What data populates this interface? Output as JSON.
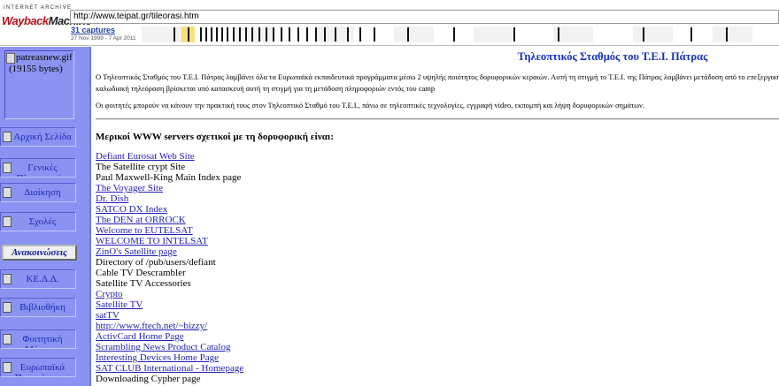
{
  "wayback": {
    "logo_top": "INTERNET ARCHIVE",
    "logo_wayback": "Wayback",
    "logo_machine": "Machine",
    "url": "http://www.teipat.gr/tileorasi.htm",
    "captures": "31 captures",
    "range": "27 Nov 1999 - 7 Apr 2011"
  },
  "nav": {
    "logo_alt_line1": "patreasnew.gif",
    "logo_alt_line2": "(19155 bytes)",
    "items": [
      {
        "label": "Αρχική Σελίδα"
      },
      {
        "label": "Γενικές Πληροφορίες"
      },
      {
        "label": "Διοίκηση"
      },
      {
        "label": "Σχολές"
      },
      {
        "label": "Ανακοινώσεις"
      },
      {
        "label": "ΚΕ.Δ.Δ."
      },
      {
        "label": "Βιβλιοθήκη"
      },
      {
        "label": "Φοιτητική Μέριμνα"
      },
      {
        "label": "Ευρωπαϊκά Προγράμματα"
      }
    ]
  },
  "main": {
    "title": "Τηλεοπτικός Σταθμός του Τ.Ε.Ι. Πάτρας",
    "intro": "Ο Τηλεοπτικός Σταθμός του Τ.Ε.Ι. Πάτρας λαμβάνει όλα τα Ευρωπαϊκά εκπαιδευτικά προγράμματα μέσω 2 υψηλής ποιότητος δορυφορικών κεραιών. Αυτή τη στιγμή το Τ.Ε.Ι. της Πάτρας λαμβάνει μετάδοση από το επεξεργασία τηλεοπτικών προγραμμάτων και τοπικής ραδιοφωνίας εκπαιδευτικών προγραμμάτων. Η καλωδιακή τηλεόραση βρίσκεται υπό κατασκευή αυτή τη στιγμή για τη μετάδοση πληροφοριών εντός του camp",
    "students": "Οι φοιτητές μπορούν να κάνουν την πρακτική τους στον Τηλεοπτικό Σταθμό του Τ.Ε.Ι., πάνω σε   τηλεοπτικές τεχνολογίες, εγγραφή video, εκπομπή και λήψη δορυφορικών σημάτων.",
    "links_heading": "Μερικοί WWW servers σχετικοί με τη δορυφορική είναι:",
    "links": [
      {
        "text": "Defiant Eurosat Web Site",
        "link": true
      },
      {
        "text": "The Satellite crypt Site",
        "link": false
      },
      {
        "text": "Paul Maxwell-King Main Index page",
        "link": false
      },
      {
        "text": "The Voyager Site",
        "link": true
      },
      {
        "text": "Dr. Dish",
        "link": true
      },
      {
        "text": "SATCO DX Index",
        "link": true
      },
      {
        "text": "The DEN at ORROCK",
        "link": true
      },
      {
        "text": "Welcome to EUTELSAT",
        "link": true
      },
      {
        "text": "WELCOME TO INTELSAT",
        "link": true
      },
      {
        "text": "ZinO's Satellite page",
        "link": true
      },
      {
        "text": "Directory of /pub/users/defiant",
        "link": false
      },
      {
        "text": "Cable TV Descrambler",
        "link": false
      },
      {
        "text": "Satellite TV Accessories",
        "link": false
      },
      {
        "text": "Crypto",
        "link": true
      },
      {
        "text": "Satellite TV",
        "link": true
      },
      {
        "text": "satTV",
        "link": true
      },
      {
        "text": "http://www.ftech.net/~bizzy/",
        "link": true
      },
      {
        "text": "ActivCard Home Page",
        "link": true
      },
      {
        "text": "Scrambling News Product Catalog",
        "link": true
      },
      {
        "text": "Interesting Devices Home Page",
        "link": true
      },
      {
        "text": "SAT CLUB International - Homepage",
        "link": true
      },
      {
        "text": "Downloading Cypher page",
        "link": false
      }
    ]
  },
  "colors": {
    "nav_bg": "#8b93f2",
    "title": "#1530b8",
    "link": "#1f1fb0",
    "wayback_red": "#b5121b"
  }
}
